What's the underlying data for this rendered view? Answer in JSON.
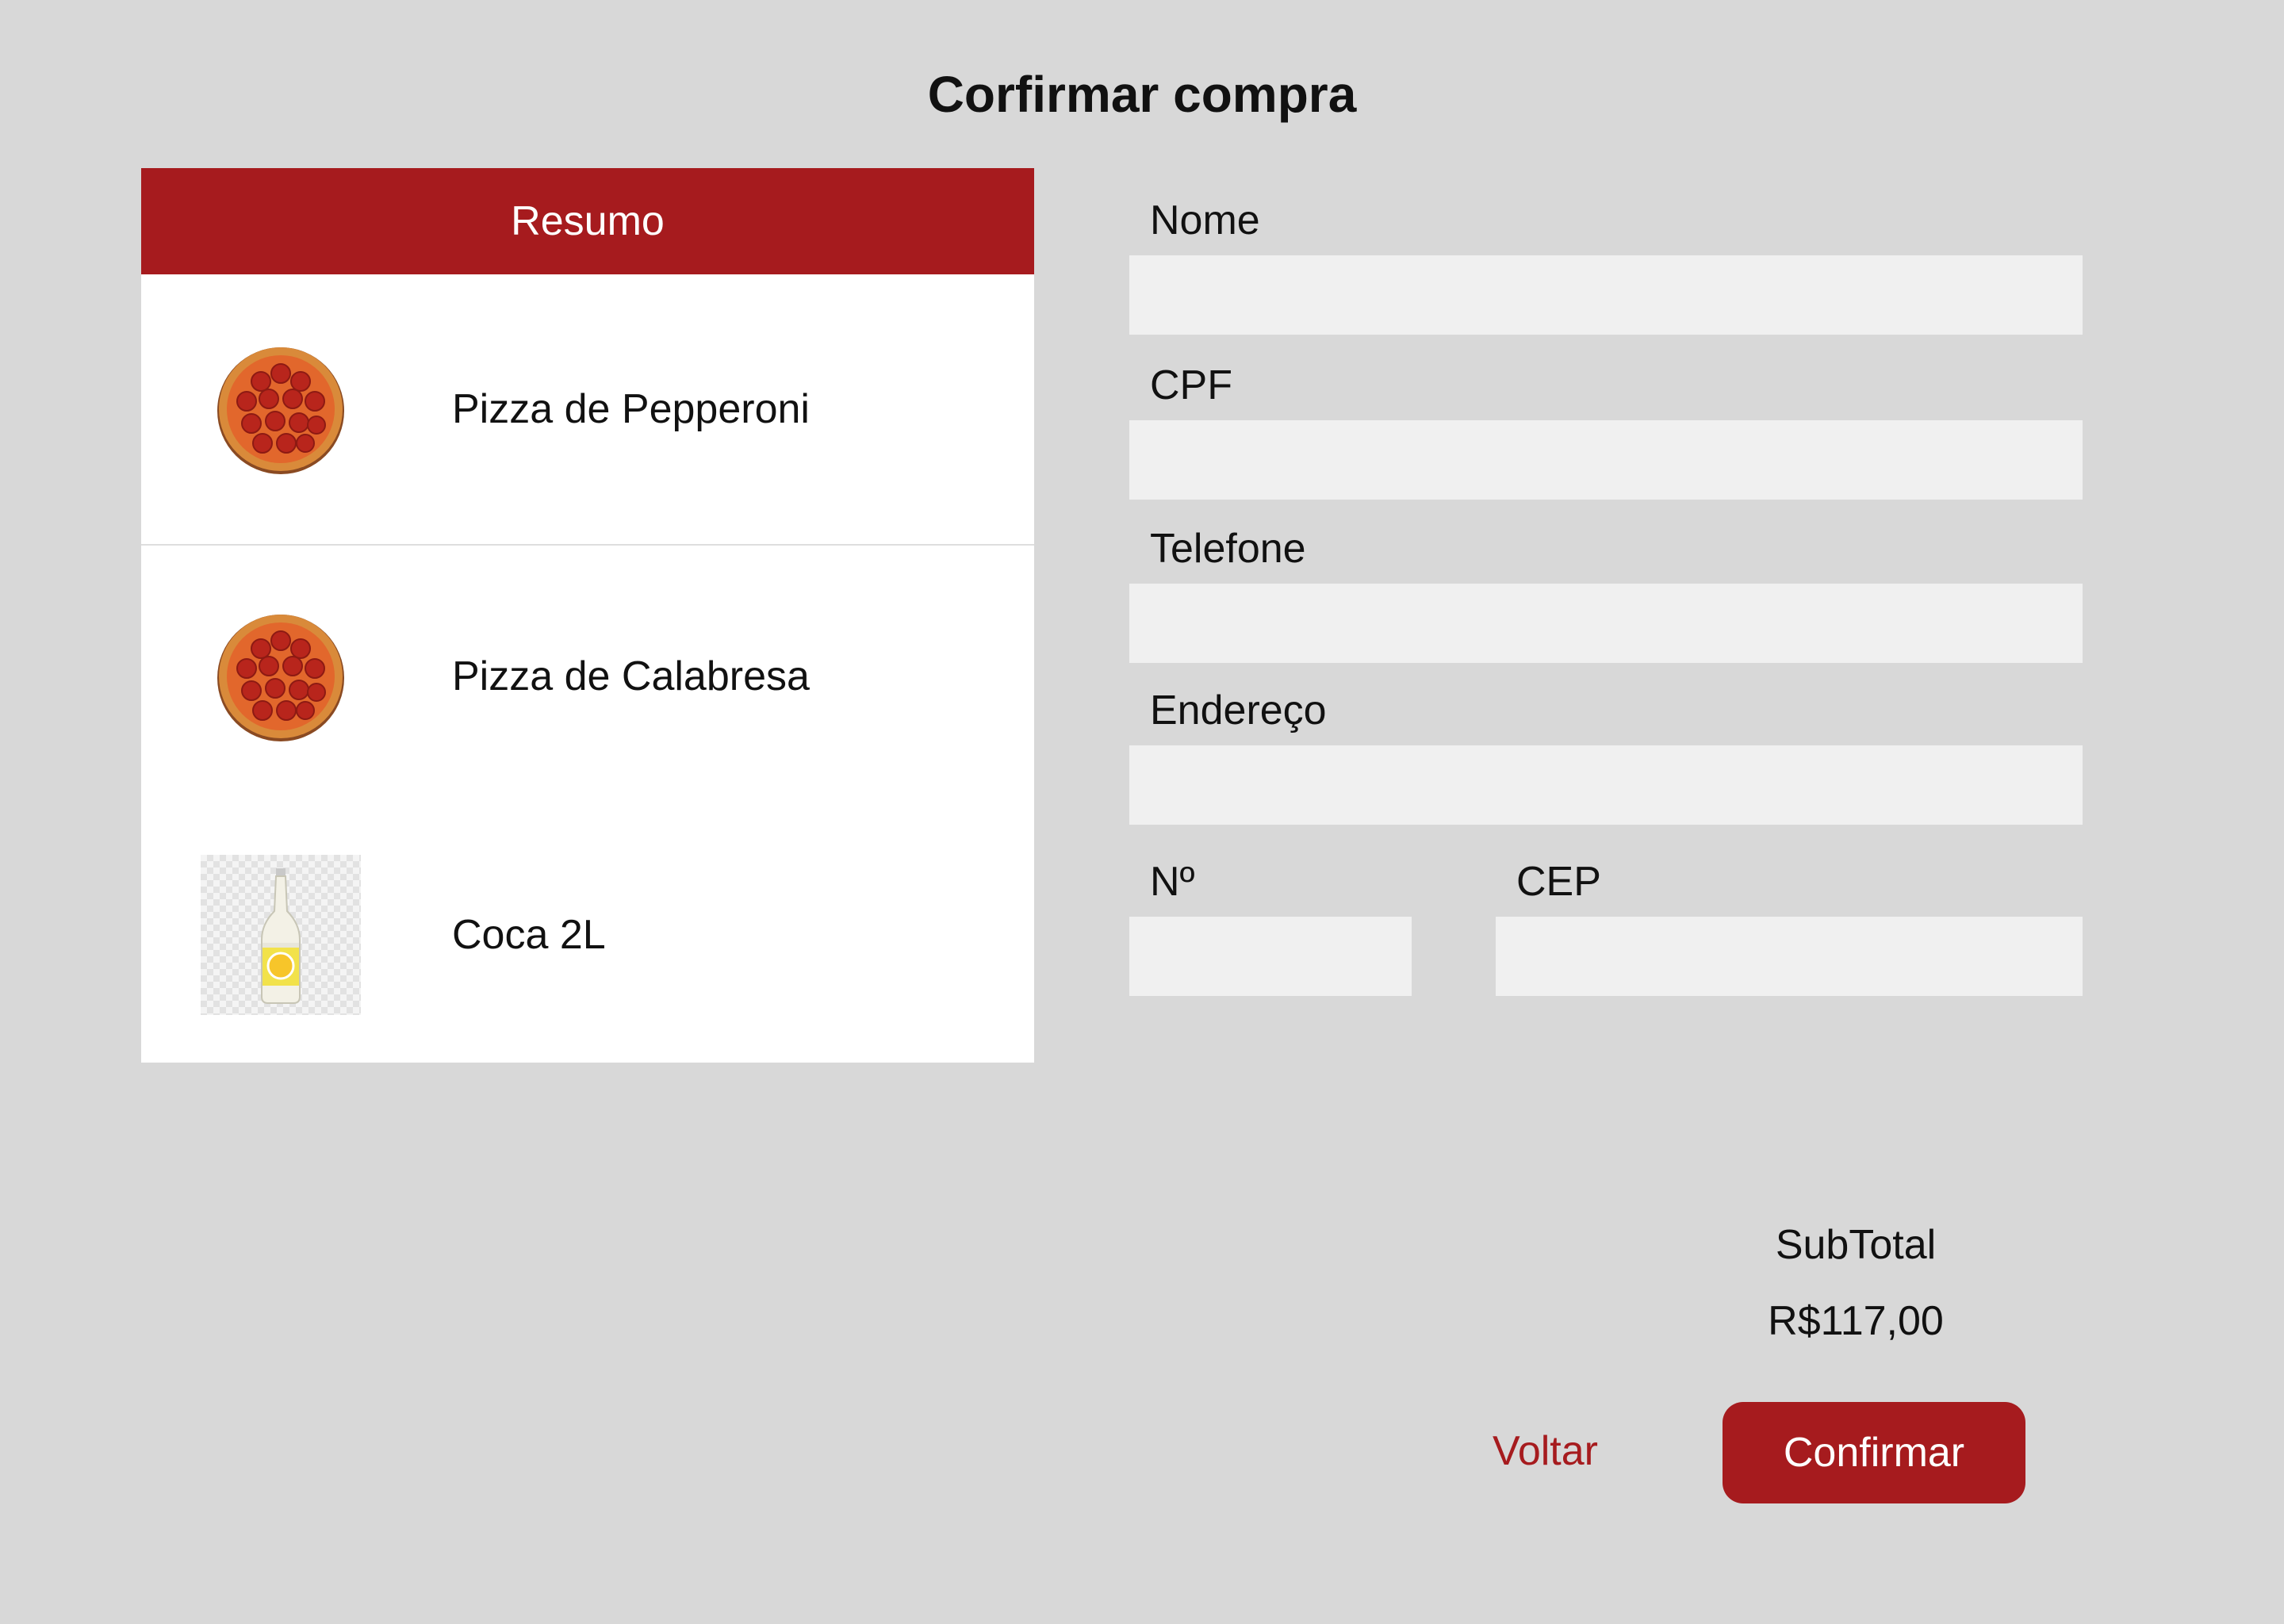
{
  "page": {
    "title": "Corfirmar compra"
  },
  "summary": {
    "header": "Resumo",
    "items": [
      {
        "label": "Pizza de Pepperoni",
        "icon": "pepperoni-pizza-icon"
      },
      {
        "label": "Pizza de Calabresa",
        "icon": "calabresa-pizza-icon"
      },
      {
        "label": "Coca 2L",
        "icon": "soda-bottle-icon"
      }
    ]
  },
  "form": {
    "nome": {
      "label": "Nome",
      "value": ""
    },
    "cpf": {
      "label": "CPF",
      "value": ""
    },
    "telefone": {
      "label": "Telefone",
      "value": ""
    },
    "endereco": {
      "label": "Endereço",
      "value": ""
    },
    "numero": {
      "label": "Nº",
      "value": ""
    },
    "cep": {
      "label": "CEP",
      "value": ""
    }
  },
  "totals": {
    "subtotal_label": "SubTotal",
    "subtotal_value": "R$117,00"
  },
  "actions": {
    "back_label": "Voltar",
    "confirm_label": "Confirmar"
  },
  "colors": {
    "accent": "#a61b1e",
    "background": "#d8d8d8",
    "input_bg": "#f0f0f0"
  }
}
